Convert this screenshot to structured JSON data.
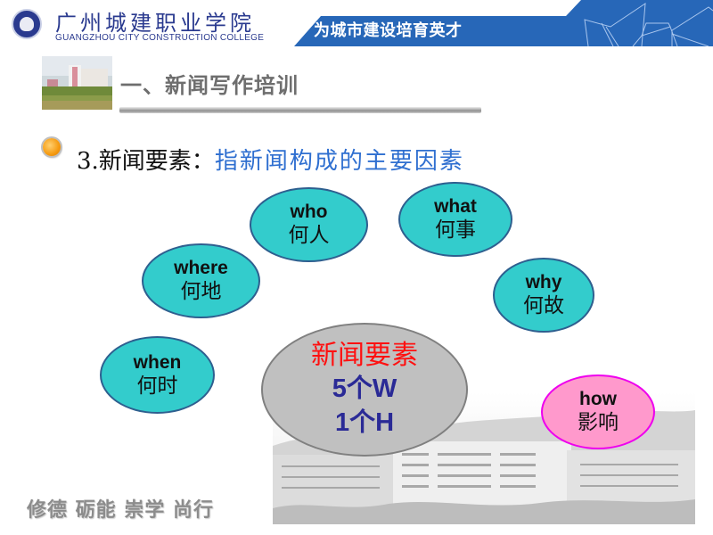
{
  "header": {
    "school_name_cn": "广州城建职业学院",
    "school_name_en": "GUANGZHOU CITY CONSTRUCTION COLLEGE",
    "slogan": "为城市建设培育英才",
    "brand_color": "#2767b8"
  },
  "section": {
    "title": "一、新闻写作培训"
  },
  "bullet": {
    "label": "3.新闻要素：",
    "definition": "指新闻构成的主要因素"
  },
  "elements": [
    {
      "key": "who",
      "en": "who",
      "cn": "何人"
    },
    {
      "key": "what",
      "en": "what",
      "cn": "何事"
    },
    {
      "key": "where",
      "en": "where",
      "cn": "何地"
    },
    {
      "key": "why",
      "en": "why",
      "cn": "何故"
    },
    {
      "key": "when",
      "en": "when",
      "cn": "何时"
    },
    {
      "key": "how",
      "en": "how",
      "cn": "影响"
    }
  ],
  "center": {
    "title": "新闻要素",
    "line1": "5个W",
    "line2": "1个H"
  },
  "colors": {
    "w_ellipse": "#33cccc",
    "h_ellipse": "#ff99cc",
    "center_ellipse": "#c0c0c0",
    "center_title": "#ff1010",
    "center_text": "#2a2a96",
    "definition_text": "#2f6fd0"
  },
  "footer": {
    "motto": "修德 砺能 崇学 尚行"
  }
}
